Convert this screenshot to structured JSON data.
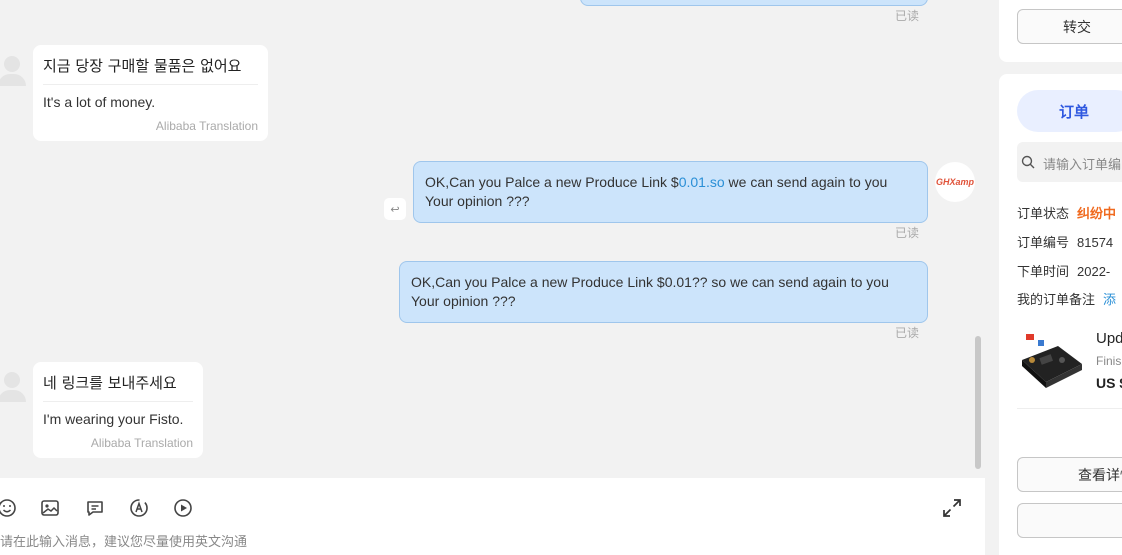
{
  "chat": {
    "messages": [
      {
        "type": "read_receipt",
        "text": "已读"
      },
      {
        "type": "incoming",
        "original": "지금 당장 구매할 물품은 없어요",
        "translation": "It's a lot of money.",
        "source": "Alibaba Translation"
      },
      {
        "type": "outgoing",
        "before_link": "OK,Can you Palce a new Produce Link $",
        "link": "0.01.so",
        "after_link": " we can send again to you",
        "line2": "Your opinion ???",
        "read": "已读",
        "avatar_text": "GHXamp"
      },
      {
        "type": "outgoing",
        "line1": "OK,Can you Palce a new Produce Link $0.01?? so we can send again to you",
        "line2": "Your opinion ???",
        "read": "已读"
      },
      {
        "type": "incoming",
        "original": "네 링크를 보내주세요",
        "translation": "I'm wearing your Fisto.",
        "source": "Alibaba Translation"
      }
    ]
  },
  "input": {
    "placeholder": "请在此输入消息，建议您尽量使用英文沟通",
    "tools": [
      "emoji-icon",
      "image-icon",
      "quick-reply-icon",
      "translate-icon",
      "video-icon"
    ],
    "expand_icon": "expand-icon"
  },
  "sidebar": {
    "transfer_button": "转交",
    "order_tab": "订单",
    "search_placeholder": "请输入订单编",
    "order_status_label": "订单状态",
    "order_status_value": "纠纷中",
    "order_no_label": "订单编号",
    "order_no_value": "81574",
    "order_time_label": "下单时间",
    "order_time_value": "2022-",
    "note_label": "我的订单备注",
    "note_link": "添",
    "product_title": "Upd",
    "product_status": "Finis",
    "product_price": "US $",
    "view_details_button": "查看详情"
  },
  "colors": {
    "outgoing_bubble": "#cce4fb",
    "link": "#2a8fd6",
    "status_dispute": "#f06a1f",
    "order_tab_text": "#2f58e0"
  }
}
